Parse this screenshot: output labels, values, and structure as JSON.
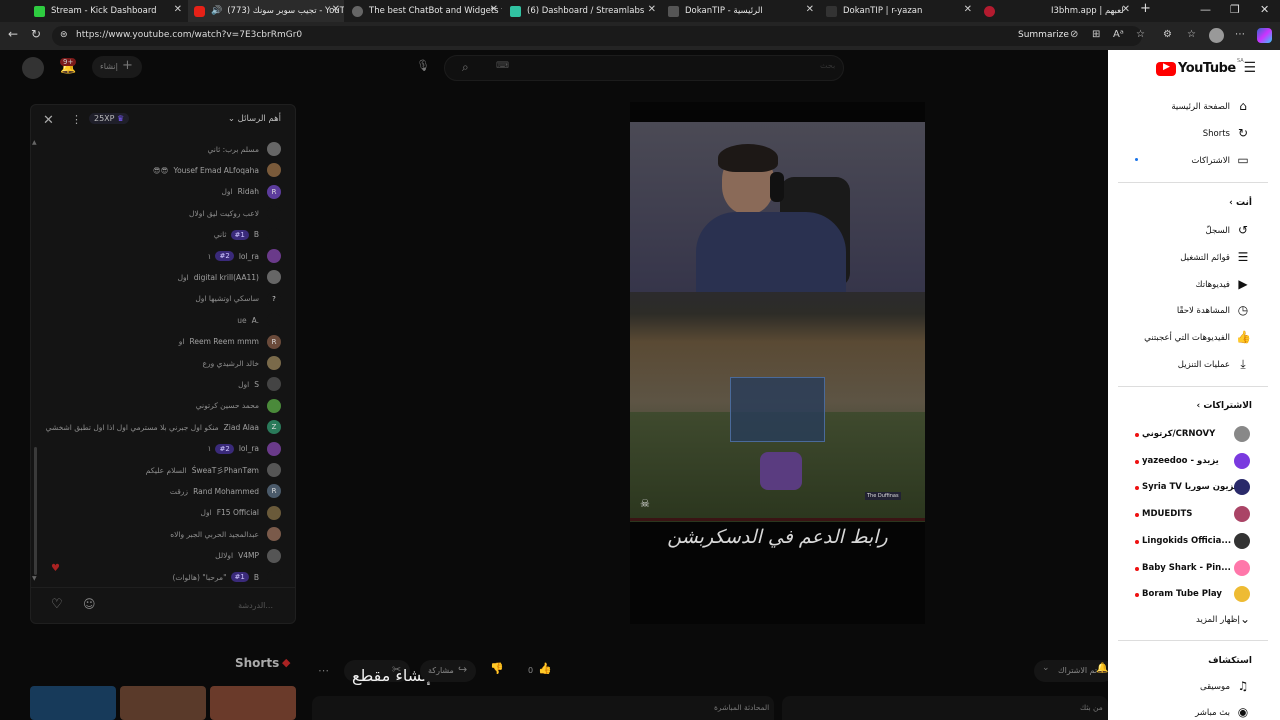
{
  "browser": {
    "tabs": [
      {
        "title": "Stream - Kick Dashboard",
        "color": "#2ecc40"
      },
      {
        "title": "(773) تجيب سوبر سونك - YouTube",
        "color": "#e62117"
      },
      {
        "title": "The best ChatBot and Widgets for",
        "color": "#666"
      },
      {
        "title": "(6) Dashboard / Streamlabs",
        "color": "#31c3a2"
      },
      {
        "title": "DokanTIP - الرئيسية",
        "color": "#555"
      },
      {
        "title": "DokanTIP | r-yazan",
        "color": "#444"
      },
      {
        "title": "I3bhm.app | لعبهم",
        "color": "#b31b2f"
      }
    ],
    "url": "https://www.youtube.com/watch?v=7E3cbrRmGr0",
    "summarize": "Summarize"
  },
  "topbar": {
    "notif_count": "9+",
    "create_label": "إنشاء",
    "search_placeholder": "بحث"
  },
  "chat": {
    "header": "أهم الرسائل",
    "xp": "25XP",
    "messages": [
      {
        "name": "",
        "text": "مسلم برب: ثاني",
        "av": "#666",
        "initial": ""
      },
      {
        "name": "Yousef Emad ALfoqaha",
        "text": "😎😎",
        "av": "#7a5a3a",
        "initial": ""
      },
      {
        "name": "Ridah",
        "text": "اول",
        "av": "#5c3c9c",
        "initial": "R"
      },
      {
        "name": "",
        "text": "لاعب روكيت ليق اولال",
        "av": "#141414",
        "initial": ""
      },
      {
        "name": "B",
        "text": "ثاني",
        "av": "#141414",
        "initial": "",
        "badge": "#1"
      },
      {
        "name": "lol_ra",
        "text": "١",
        "av": "#6a3a8a",
        "initial": "",
        "badge": "#2"
      },
      {
        "name": "digital krill(AA11)",
        "text": "اول",
        "av": "#666",
        "initial": ""
      },
      {
        "name": "",
        "text": "ساسكي اوتشيها اول",
        "av": "#141414",
        "initial": "?"
      },
      {
        "name": "A.",
        "text": "ue",
        "av": "#141414",
        "initial": ""
      },
      {
        "name": "Reem Reem mmm",
        "text": "او",
        "av": "#6a4a3a",
        "initial": "R"
      },
      {
        "name": "",
        "text": "خالد الرشيدي ورع",
        "av": "#7a6a4a",
        "initial": ""
      },
      {
        "name": "S",
        "text": "اول",
        "av": "#444",
        "initial": ""
      },
      {
        "name": "",
        "text": "محمد حسين كرتوني",
        "av": "#4a8a3a",
        "initial": ""
      },
      {
        "name": "Ziad Alaa",
        "text": "منكو اول جبرني بلا مسترمي اول اذا اول تطبق اشخشي",
        "av": "#2a7a5a",
        "initial": "Z"
      },
      {
        "name": "lol_ra",
        "text": "١",
        "av": "#6a3a8a",
        "initial": "",
        "badge": "#2"
      },
      {
        "name": "ŚweaT彡PhanTøm",
        "text": "السلام عليكم",
        "av": "#555",
        "initial": ""
      },
      {
        "name": "Rand Mohammed",
        "text": "زرقت",
        "av": "#4a5a6a",
        "initial": "R"
      },
      {
        "name": "F15 Official",
        "text": "اول",
        "av": "#6a5a3a",
        "initial": ""
      },
      {
        "name": "",
        "text": "عبدالمجيد الحربي الجبر والاه",
        "av": "#7a5a4a",
        "initial": ""
      },
      {
        "name": "V4MP",
        "text": "اولالل",
        "av": "#555",
        "initial": ""
      },
      {
        "name": "B",
        "text": "(هالوات) \"مرحبا\"",
        "av": "#141414",
        "initial": "",
        "badge": "#1"
      }
    ],
    "input_placeholder": "الدردشة..."
  },
  "video": {
    "overlay_text": "رابط الدعم في الدسكربشن",
    "streamer_tag": "The Duffinas"
  },
  "below": {
    "shorts_label": "Shorts",
    "clip_label": "إنشاء مقطع",
    "share_label": "مشاركة",
    "like_count": "0",
    "subscribed_label": "تم الاشتراك",
    "live_chat_label": "المحادثة المباشرة",
    "from_label": "من بثك"
  },
  "sidebar": {
    "logo": "YouTube",
    "logo_sup": "SA",
    "main": [
      {
        "label": "الصفحة الرئيسية",
        "icon": "⌂"
      },
      {
        "label": "Shorts",
        "icon": "↻"
      },
      {
        "label": "الاشتراكات",
        "icon": "▭"
      }
    ],
    "you_header": "أنت",
    "you": [
      {
        "label": "السجلّ",
        "icon": "↺"
      },
      {
        "label": "قوائم التشغيل",
        "icon": "☰"
      },
      {
        "label": "فيديوهاتك",
        "icon": "▶"
      },
      {
        "label": "المشاهدة لاحقًا",
        "icon": "◷"
      },
      {
        "label": "الفيديوهات التي أعجبتني",
        "icon": "👍"
      },
      {
        "label": "عمليات التنزيل",
        "icon": "⤓"
      }
    ],
    "subs_header": "الاشتراكات",
    "subs": [
      {
        "label": "كرتوني/CRNOVY",
        "color": "#888"
      },
      {
        "label": "yazeedoo - يزيدو",
        "color": "#7a3adf"
      },
      {
        "label": "Syria TV تلفزيون سوريا",
        "color": "#2a2a6a"
      },
      {
        "label": "MDUEDITS",
        "color": "#a46"
      },
      {
        "label": "Lingokids Officia...",
        "color": "#333"
      },
      {
        "label": "Baby Shark - Pin...",
        "color": "#f7a"
      },
      {
        "label": "Boram Tube Play",
        "color": "#eb3"
      }
    ],
    "show_more": "إظهار المزيد",
    "explore_header": "استكشاف",
    "explore": [
      {
        "label": "موسيقى",
        "icon": "♫"
      },
      {
        "label": "بث مباشر",
        "icon": "◉"
      }
    ]
  }
}
